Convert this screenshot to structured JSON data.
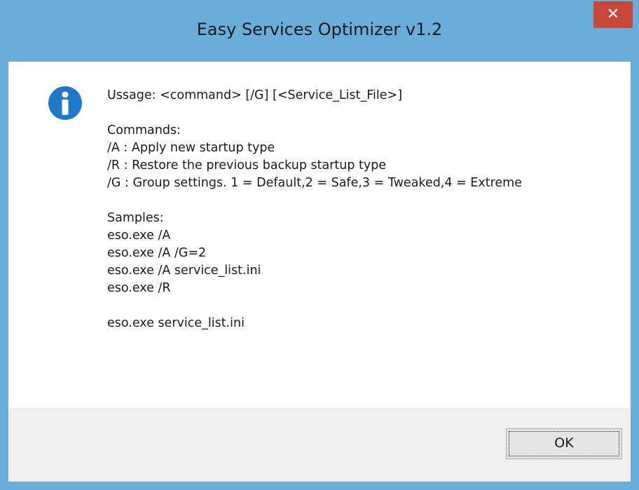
{
  "window": {
    "title": "Easy Services Optimizer v1.2",
    "close_label": "✕"
  },
  "icon": "info-icon",
  "message": {
    "usage": "Ussage: <command> [/G] [<Service_List_File>]",
    "commands_header": "Commands:",
    "commands": [
      "/A : Apply new startup type",
      "/R : Restore the previous backup startup type",
      "/G : Group settings. 1 = Default,2 = Safe,3 = Tweaked,4 = Extreme"
    ],
    "samples_header": "Samples:",
    "samples": [
      "eso.exe /A",
      "eso.exe /A /G=2",
      "eso.exe /A service_list.ini",
      "eso.exe /R"
    ],
    "extra_sample": "eso.exe service_list.ini"
  },
  "buttons": {
    "ok_label": "OK"
  },
  "colors": {
    "frame": "#6badd9",
    "close_button": "#c9463a",
    "info_icon": "#1f78c8",
    "footer": "#f0f0f0"
  }
}
